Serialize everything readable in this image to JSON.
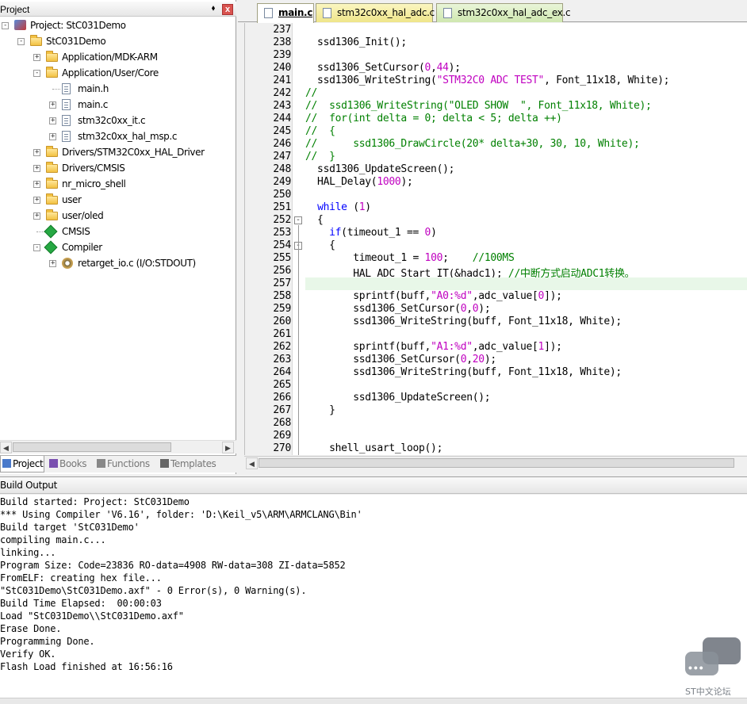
{
  "project_panel": {
    "title": "Project",
    "pin": "⬧",
    "close": "x",
    "tree": [
      {
        "label": "Project: StC031Demo",
        "icon": "project-icon",
        "depth": 0,
        "toggle": "-"
      },
      {
        "label": "StC031Demo",
        "icon": "target-icon",
        "depth": 1,
        "toggle": "-"
      },
      {
        "label": "Application/MDK-ARM",
        "icon": "folder-icon",
        "depth": 2,
        "toggle": "+"
      },
      {
        "label": "Application/User/Core",
        "icon": "folder-icon",
        "depth": 2,
        "toggle": "-"
      },
      {
        "label": "main.h",
        "icon": "file-icon",
        "depth": 3,
        "toggle": ""
      },
      {
        "label": "main.c",
        "icon": "file-icon",
        "depth": 3,
        "toggle": "+"
      },
      {
        "label": "stm32c0xx_it.c",
        "icon": "file-icon",
        "depth": 3,
        "toggle": "+"
      },
      {
        "label": "stm32c0xx_hal_msp.c",
        "icon": "file-icon",
        "depth": 3,
        "toggle": "+"
      },
      {
        "label": "Drivers/STM32C0xx_HAL_Driver",
        "icon": "folder-icon",
        "depth": 2,
        "toggle": "+"
      },
      {
        "label": "Drivers/CMSIS",
        "icon": "folder-icon",
        "depth": 2,
        "toggle": "+"
      },
      {
        "label": "nr_micro_shell",
        "icon": "folder-icon",
        "depth": 2,
        "toggle": "+"
      },
      {
        "label": "user",
        "icon": "folder-icon",
        "depth": 2,
        "toggle": "+"
      },
      {
        "label": "user/oled",
        "icon": "folder-icon",
        "depth": 2,
        "toggle": "+"
      },
      {
        "label": "CMSIS",
        "icon": "component-icon",
        "depth": 2,
        "toggle": ""
      },
      {
        "label": "Compiler",
        "icon": "component-icon",
        "depth": 2,
        "toggle": "-"
      },
      {
        "label": "retarget_io.c (I/O:STDOUT)",
        "icon": "gear-file-icon",
        "depth": 3,
        "toggle": "+"
      }
    ],
    "tabs": [
      {
        "label": "Project",
        "icon": "project-tab-icon",
        "active": true
      },
      {
        "label": "Books",
        "icon": "books-icon",
        "active": false
      },
      {
        "label": "Functions",
        "icon": "functions-icon",
        "active": false
      },
      {
        "label": "Templates",
        "icon": "templates-icon",
        "active": false
      }
    ]
  },
  "editor": {
    "tabs": [
      {
        "label": "main.c",
        "active": true
      },
      {
        "label": "stm32c0xx_hal_adc.c",
        "active": false
      },
      {
        "label": "stm32c0xx_hal_adc_ex.c",
        "active": false
      }
    ],
    "lines": [
      {
        "n": "237",
        "text": ""
      },
      {
        "n": "238",
        "text": "  ssd1306_Init();"
      },
      {
        "n": "239",
        "text": ""
      },
      {
        "n": "240",
        "text": "  ssd1306_SetCursor(0,44);"
      },
      {
        "n": "241",
        "text": "  ssd1306_WriteString(\"STM32C0 ADC TEST\", Font_11x18, White);"
      },
      {
        "n": "242",
        "text": "//"
      },
      {
        "n": "243",
        "text": "//  ssd1306_WriteString(\"OLED SHOW  \", Font_11x18, White);"
      },
      {
        "n": "244",
        "text": "//  for(int delta = 0; delta < 5; delta ++)"
      },
      {
        "n": "245",
        "text": "//  {"
      },
      {
        "n": "246",
        "text": "//      ssd1306_DrawCircle(20* delta+30, 30, 10, White);"
      },
      {
        "n": "247",
        "text": "//  }"
      },
      {
        "n": "248",
        "text": "  ssd1306_UpdateScreen();"
      },
      {
        "n": "249",
        "text": "  HAL_Delay(1000);"
      },
      {
        "n": "250",
        "text": ""
      },
      {
        "n": "251",
        "text": "  while (1)"
      },
      {
        "n": "252",
        "text": "  {"
      },
      {
        "n": "253",
        "text": "    if(timeout_1 == 0)"
      },
      {
        "n": "254",
        "text": "    {"
      },
      {
        "n": "255",
        "text": "        timeout_1 = 100;    //100MS"
      },
      {
        "n": "256",
        "text": "        HAL_ADC_Start_IT(&hadc1); //中断方式启动ADC1转换。"
      },
      {
        "n": "257",
        "text": "        "
      },
      {
        "n": "258",
        "text": "        sprintf(buff,\"A0:%d\",adc_value[0]);"
      },
      {
        "n": "259",
        "text": "        ssd1306_SetCursor(0,0);"
      },
      {
        "n": "260",
        "text": "        ssd1306_WriteString(buff, Font_11x18, White);"
      },
      {
        "n": "261",
        "text": ""
      },
      {
        "n": "262",
        "text": "        sprintf(buff,\"A1:%d\",adc_value[1]);"
      },
      {
        "n": "263",
        "text": "        ssd1306_SetCursor(0,20);"
      },
      {
        "n": "264",
        "text": "        ssd1306_WriteString(buff, Font_11x18, White);"
      },
      {
        "n": "265",
        "text": ""
      },
      {
        "n": "266",
        "text": "        ssd1306_UpdateScreen();"
      },
      {
        "n": "267",
        "text": "    }"
      },
      {
        "n": "268",
        "text": ""
      },
      {
        "n": "269",
        "text": ""
      },
      {
        "n": "270",
        "text": "    shell_usart_loop();"
      }
    ],
    "current_line": "257",
    "fold_markers": [
      "252",
      "254"
    ]
  },
  "build_output": {
    "title": "Build Output",
    "lines": [
      "Build started: Project: StC031Demo",
      "*** Using Compiler 'V6.16', folder: 'D:\\Keil_v5\\ARM\\ARMCLANG\\Bin'",
      "Build target 'StC031Demo'",
      "compiling main.c...",
      "linking...",
      "Program Size: Code=23836 RO-data=4908 RW-data=308 ZI-data=5852",
      "FromELF: creating hex file...",
      "\"StC031Demo\\StC031Demo.axf\" - 0 Error(s), 0 Warning(s).",
      "Build Time Elapsed:  00:00:03",
      "Load \"StC031Demo\\\\StC031Demo.axf\"",
      "Erase Done.",
      "Programming Done.",
      "Verify OK.",
      "Flash Load finished at 16:56:16"
    ]
  },
  "watermark": {
    "text": "ST中文论坛",
    "dots": "•••"
  },
  "colors": {
    "comment": "#008000",
    "string": "#c000c0",
    "keyword": "#0000ff",
    "current_line": "#e8f7e8",
    "tab_yellow": "#f5eca0"
  }
}
